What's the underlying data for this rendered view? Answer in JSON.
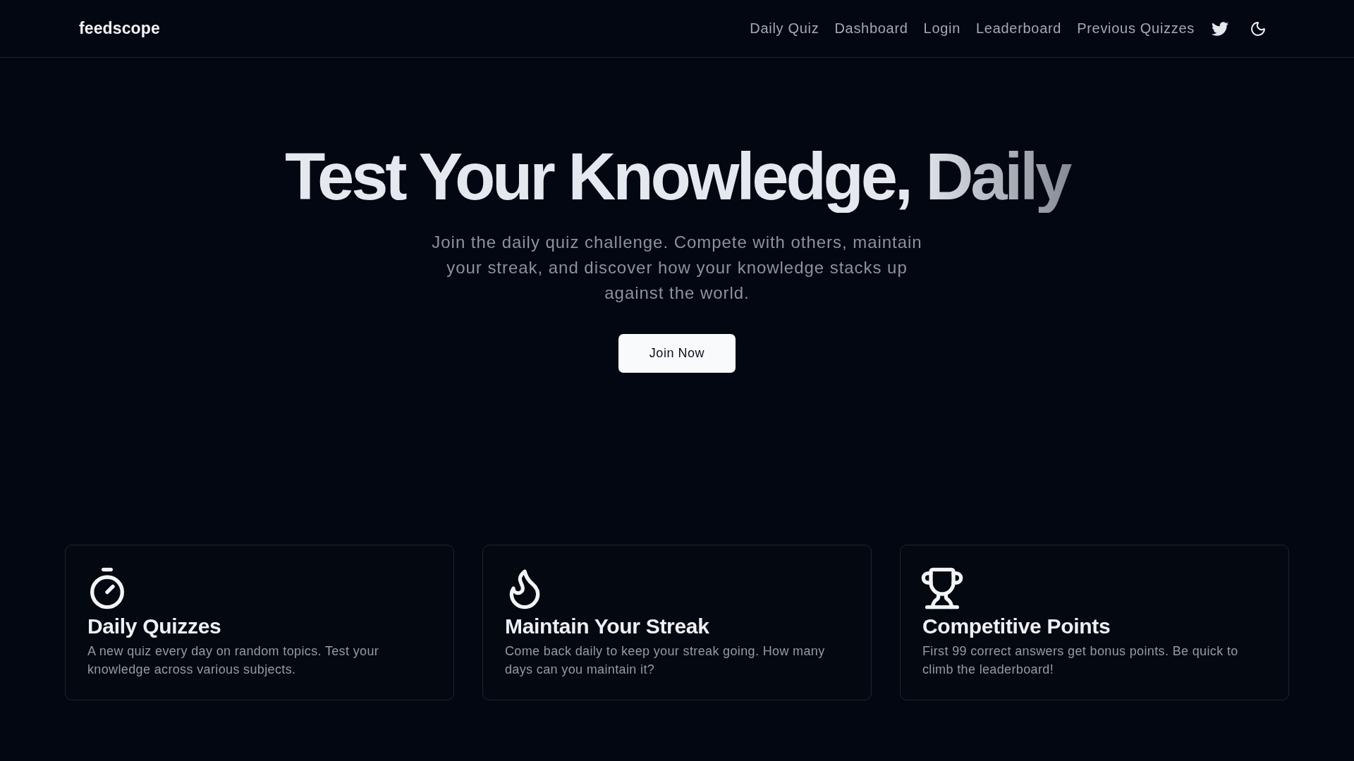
{
  "header": {
    "logo": "feedscope",
    "nav": [
      {
        "label": "Daily Quiz"
      },
      {
        "label": "Dashboard"
      },
      {
        "label": "Login"
      },
      {
        "label": "Leaderboard"
      },
      {
        "label": "Previous Quizzes"
      }
    ]
  },
  "hero": {
    "title": "Test Your Knowledge, Daily",
    "subtitle": "Join the daily quiz challenge. Compete with others, maintain your streak, and discover how your knowledge stacks up against the world.",
    "button": "Join Now"
  },
  "features": [
    {
      "kind": "timer",
      "title": "Daily Quizzes",
      "description": "A new quiz every day on random topics. Test your knowledge across various subjects."
    },
    {
      "kind": "flame",
      "title": "Maintain Your Streak",
      "description": "Come back daily to keep your streak going. How many days can you maintain it?"
    },
    {
      "kind": "trophy",
      "title": "Competitive Points",
      "description": "First 99 correct answers get bonus points. Be quick to climb the leaderboard!"
    }
  ]
}
